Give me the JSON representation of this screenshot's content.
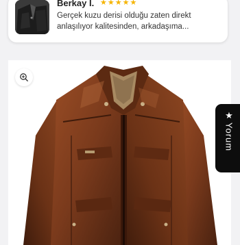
{
  "review": {
    "reviewer_name": "Berkay I.",
    "rating": 5,
    "stars": "★★★★★",
    "text": "Gerçek kuzu derisi olduğu zaten direkt anlaşılıyor kalitesinden, arkadaşıma..."
  },
  "product": {
    "zoom_icon": "zoom-in-icon"
  },
  "side_tab": {
    "icon": "star-icon",
    "label": "Yorum"
  },
  "colors": {
    "star": "#f5b400",
    "tab_background": "#0d0d0d",
    "jacket_main": "#7a3a1c",
    "jacket_shadow": "#4a2210"
  }
}
